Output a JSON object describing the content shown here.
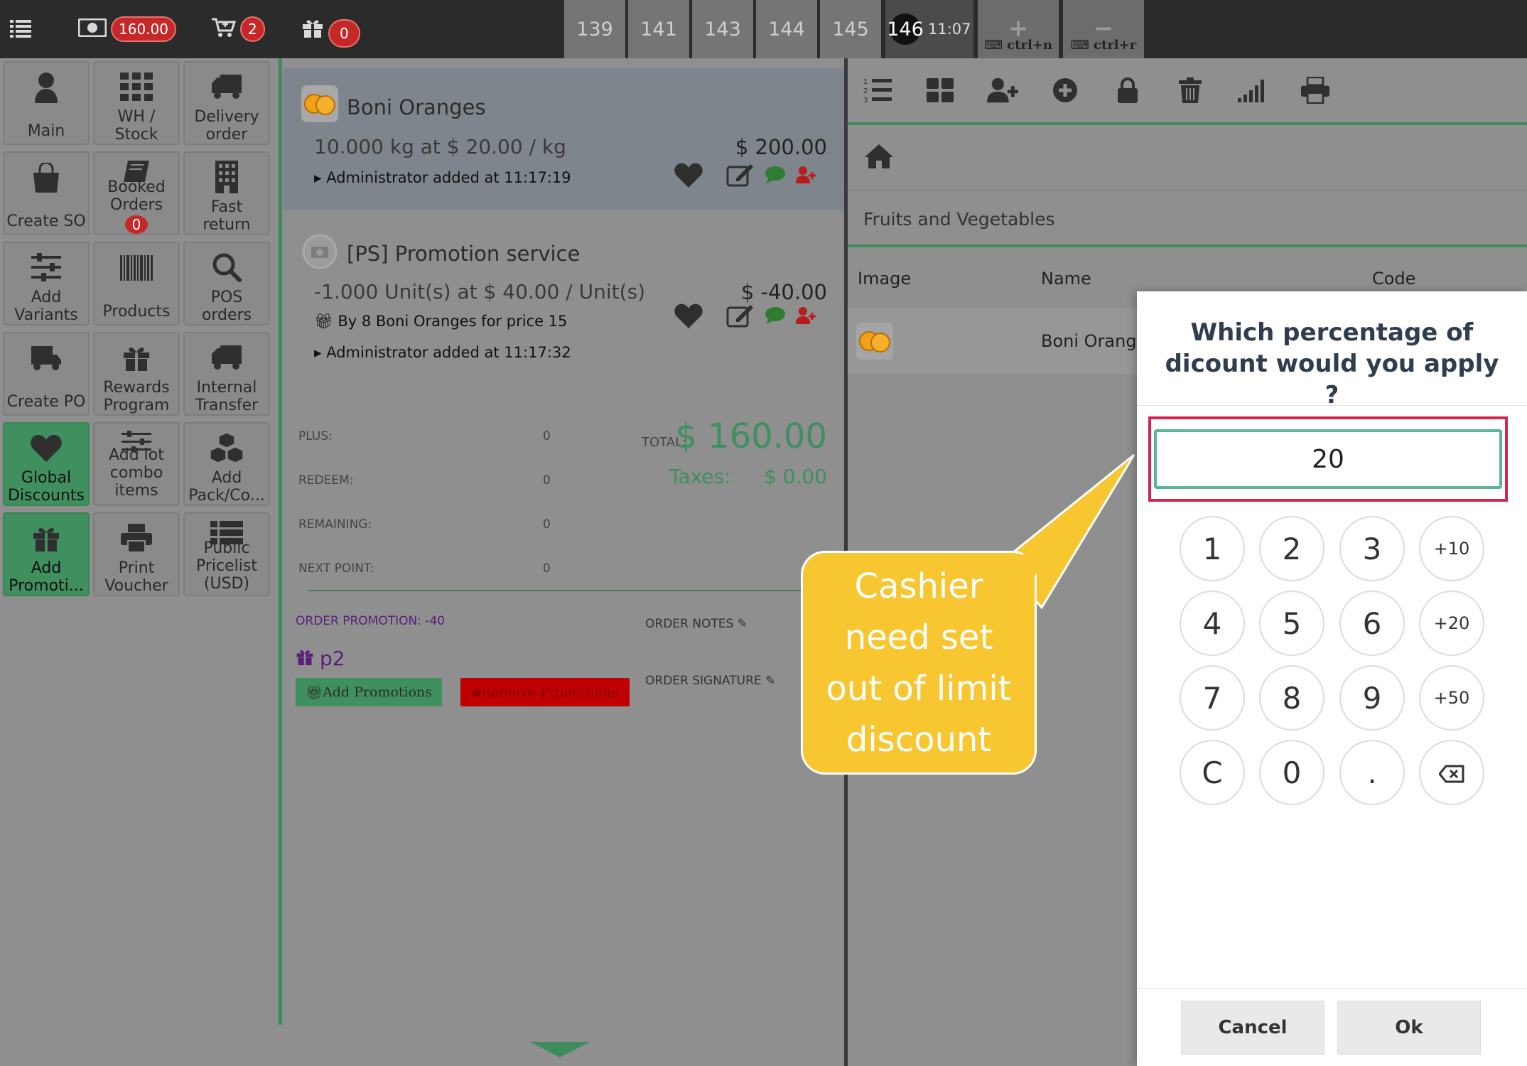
{
  "topbar": {
    "cash_amount": "160.00",
    "cart_count": "2",
    "gift_count": "0",
    "order_tabs": [
      "139",
      "141",
      "143",
      "144",
      "145"
    ],
    "active_order": {
      "number": "146",
      "time": "11:07"
    },
    "new_order_shortcut": "ctrl+n",
    "remove_order_shortcut": "ctrl+r"
  },
  "left_menu": {
    "items": [
      {
        "label": "Main"
      },
      {
        "label": "WH /\nStock"
      },
      {
        "label": "Delivery\norder"
      },
      {
        "label": "Create SO"
      },
      {
        "label": "Booked\nOrders",
        "badge": "0"
      },
      {
        "label": "Fast\nreturn"
      },
      {
        "label": "Add\nVariants"
      },
      {
        "label": "Products"
      },
      {
        "label": "POS\norders"
      },
      {
        "label": "Create PO"
      },
      {
        "label": "Rewards\nProgram"
      },
      {
        "label": "Internal\nTransfer"
      },
      {
        "label": "Global\nDiscounts"
      },
      {
        "label": "Add lot\ncombo\nitems"
      },
      {
        "label": "Add\nPack/Co..."
      },
      {
        "label": "Add\nPromoti..."
      },
      {
        "label": "Print\nVoucher"
      },
      {
        "label": "Public\nPricelist\n(USD)"
      }
    ]
  },
  "order": {
    "lines": [
      {
        "name": "Boni Oranges",
        "qty_text": "10.000 kg at $ 20.00 / kg",
        "price": "$ 200.00",
        "notes": [
          "Administrator added at 11:17:19"
        ]
      },
      {
        "name": "[PS] Promotion service",
        "qty_text": "-1.000 Unit(s) at $ 40.00 / Unit(s)",
        "price": "$ -40.00",
        "notes": [
          "By 8 Boni Oranges for price 15",
          "Administrator added at 11:17:32"
        ]
      }
    ],
    "summary": {
      "plus_label": "PLUS:",
      "plus": "0",
      "redeem_label": "REDEEM:",
      "redeem": "0",
      "remaining_label": "REMAINING:",
      "remaining": "0",
      "next_point_label": "NEXT POINT:",
      "next_point": "0"
    },
    "total_label": "TOTAL:",
    "total": "$ 160.00",
    "taxes_label": "Taxes:",
    "taxes": "$ 0.00",
    "order_promotion": "ORDER PROMOTION: -40",
    "promotion_name": "p2",
    "add_promotions": "Add Promotions",
    "remove_promotions": "Remove Promotions",
    "order_notes": "ORDER NOTES",
    "order_signature": "ORDER SIGNATURE"
  },
  "products": {
    "category": "Fruits and Vegetables",
    "columns": [
      "Image",
      "Name",
      "Code"
    ],
    "rows": [
      {
        "name": "Boni Oranges"
      }
    ]
  },
  "callout": {
    "text": "Cashier need set out of limit discount"
  },
  "dialog": {
    "title": "Which percentage of dicount would you apply ?",
    "value": "20",
    "keys": [
      "1",
      "2",
      "3",
      "+10",
      "4",
      "5",
      "6",
      "+20",
      "7",
      "8",
      "9",
      "+50",
      "C",
      "0",
      "."
    ],
    "cancel": "Cancel",
    "ok": "Ok"
  },
  "colors": {
    "accent_green": "#3f8f5f",
    "badge_red": "#c62828",
    "highlight": "#d6244a",
    "callout": "#f7c630",
    "input_border": "#5ab793"
  }
}
